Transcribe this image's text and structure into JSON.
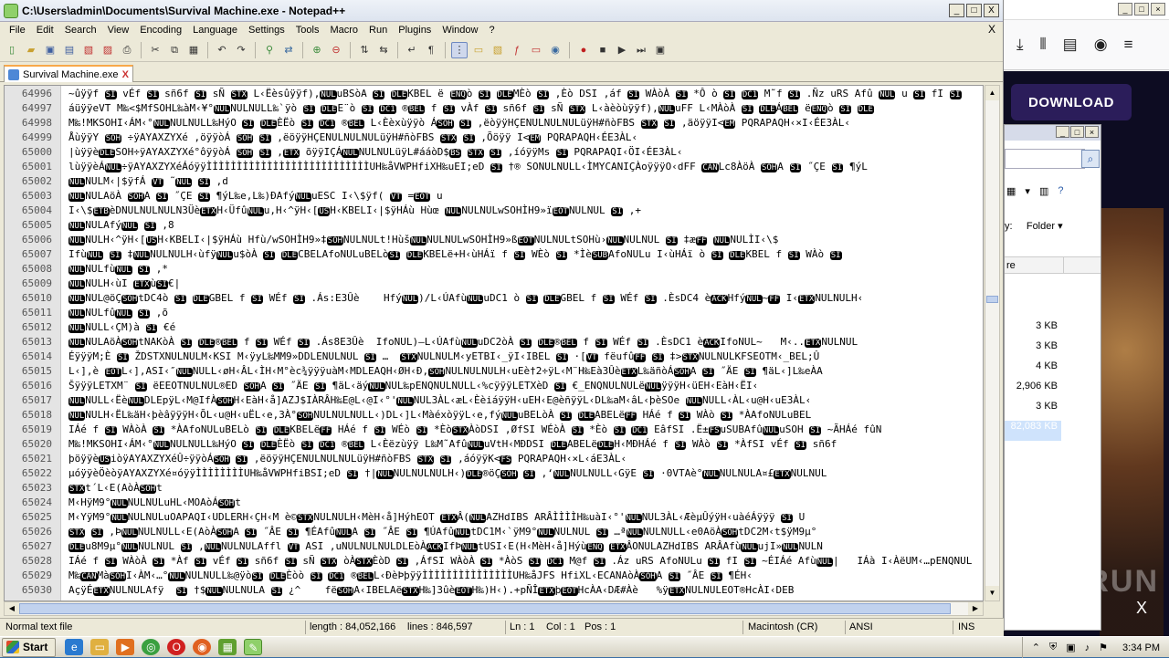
{
  "window": {
    "title": "C:\\Users\\admin\\Documents\\Survival Machine.exe - Notepad++",
    "controls": {
      "minimize": "_",
      "maximize": "□",
      "close": "X"
    }
  },
  "menu": [
    "File",
    "Edit",
    "Search",
    "View",
    "Encoding",
    "Language",
    "Settings",
    "Tools",
    "Macro",
    "Run",
    "Plugins",
    "Window",
    "?"
  ],
  "menu_close": "X",
  "toolbar_icons": [
    "new-file-icon",
    "open-file-icon",
    "save-icon",
    "save-all-icon",
    "close-icon",
    "close-all-icon",
    "print-icon",
    "cut-icon",
    "copy-icon",
    "paste-icon",
    "undo-icon",
    "redo-icon",
    "find-icon",
    "replace-icon",
    "zoom-in-icon",
    "zoom-out-icon",
    "sync-v-icon",
    "sync-h-icon",
    "wrap-icon",
    "all-chars-icon",
    "indent-guide-icon",
    "udl-icon",
    "doc-map-icon",
    "function-list-icon",
    "folder-workspace-icon",
    "monitor-icon",
    "record-macro-icon",
    "stop-macro-icon",
    "play-macro-icon",
    "run-macro-multiple-icon",
    "save-macro-icon"
  ],
  "tab": {
    "label": "Survival Machine.exe",
    "close": "X"
  },
  "lines": [
    {
      "n": "64996",
      "t": "~ûÿÿf SI vÉf SI sñ6f SI sÑ STX L‹Ëèsûÿÿf)‚NULuBSòA SI DLEKBEL ë ENQò SI DLEMÈò SI ,Èò DSI ,áf SI WÀòÀ SI *Ô ò SI DC1 M˜f SI .Ñz uRS Afû NUL u SI fI SI"
    },
    {
      "n": "64997",
      "t": "áüÿÿeVT M‰<$MfSOHL‰àM‹¥°NULNULNULL‰`ÿò SI DLEE¨ò SI DC1 ®BEL f SI vÀf SI sñ6f SI sÑ STX L‹àèòùÿÿf)‚NULuFF L‹MÀòÀ SI DLEÁBEL ëENQò SI DLE"
    },
    {
      "n": "64998",
      "t": "M‰!MKSOHI‹ÁM‹°NULNULNULL‰HýO SI DLEÈËò SI DC1 ®BEL L‹Èèxùÿÿò ÁSOH SI ,ëòÿÿHÇENULNULNULüÿH#ñòFBS STX SI ,äöÿÿI<EM PQRAPAQH‹×I‹ÉE3ÀL‹"
    },
    {
      "n": "64999",
      "t": "ÅùÿÿY SOH ÷ÿAYAXZYXé ,öÿÿòÁ SOH SI ,ëöÿÿHÇENULNULNULüÿH#ñòFBS STX SI ,Õöÿÿ I<EM PQRAPAQH‹ÉE3ÀL‹"
    },
    {
      "n": "65000",
      "t": "|ùÿÿèDLESOH÷ÿAYAXZYXé°ôÿÿòÁ SOH SI ,ETX õÿÿIÇÁNULNULNULüÿL#ááòD$BS STX SI ,íóÿÿMs SI PQRAPAQI‹ÖI‹ÉE3ÀL‹"
    },
    {
      "n": "65001",
      "t": "lùÿÿèÁNUL÷ÿAYAXZYXéÁóÿÿÌÌÌÌÌÌÌÌÌÌÌÌÌÌÌÌÌÌÌÌÌÌÌÌÌÌÌUH‰åVWPHfiXH‰uEI;eD SI †® SONULNULL‹ÌMYCANIÇÀoÿÿÿO‹dFF CANLc8ÀöÀ SOHA SI ˝ÇE SI ¶ýL"
    },
    {
      "n": "65002",
      "t": "NULNULM‹|$ÿfÁ VT ˜NUL SI ,d"
    },
    {
      "n": "65003",
      "t": "NULNULAöÀ SOHA SI ˝ÇE SI ¶ýL‰e,L‰)ÐAfýNULuESC I‹\\$ÿf( VT =EOT u"
    },
    {
      "n": "65004",
      "t": "I‹\\$ETBèDNULNULNULN3ÜèETXH‹ÜfûNULu,H‹^ÿH‹[USH‹KBELI‹|$ÿHÁù Hùœ NULNULNULwSOHÌH9»ïEOTNULNUL SI ,+"
    },
    {
      "n": "65005",
      "t": "NULNULAfýNUL SI ,8"
    },
    {
      "n": "65006",
      "t": "NULNULH‹^ÿH‹[USH‹KBELI‹|$ÿHÁù Hfù/wSOHÌH9»‡SOHNULNULt!HùšNULNULNULwSOHÌH9»ßEOTNULNULtSOHù›NULNULNUL SI ‡æFF NULNULÌI‹\\$"
    },
    {
      "n": "65007",
      "t": "IfùNUL SI ‡NULNULNULH‹ùfÿNULu$òÀ SI DLECBELAfoNULuBELòSI DLEKBELë+H‹ùHÁï f SI WÈò SI *ÌèSUBAfoNULu I‹ùHÁï ò SI DLEKBEL f SI WÀò SI"
    },
    {
      "n": "65008",
      "t": "NULNULfùNUL SI ,*"
    },
    {
      "n": "65009",
      "t": "NULNULH‹ùI ETXùSI€|"
    },
    {
      "n": "65010",
      "t": "NULNUL@öÇSOHtDC4ò SI DLEGBEL f SI WÉf SI .Ás:E3Ûè    HfýNUL)/L‹ÚAfùNULuDC1 ò SI DLEGBEL f SI WÉf SI .ÈsDC4 èACKHfýNUL~FF I‹ETXNULNULH‹"
    },
    {
      "n": "65011",
      "t": "NULNULfûNUL SI ,õ"
    },
    {
      "n": "65012",
      "t": "NULNULL‹ÇM)à SI €é"
    },
    {
      "n": "65013",
      "t": "NULNULAöÀSOHtNAKòÀ SI DLE®BEL f SI WÉf SI .Ás8E3Ûè  IfoNUL)–L‹ÚAfùNULuDC2òÀ SI DLE®BEL f SI WÉf SI .ÈsDC1 èACKIfoNUL~   M‹..ETXNULNUL"
    },
    {
      "n": "65014",
      "t": "ÉÿÿÿM;È SI ŽDSTXNULNULM‹KSI M‹ÿyL‰MM9»DDLENULNUL SI …  STXNULNULM‹yETBI‹_ÿI‹IBEL SI ·[VT fëufûFF SI ‡>STXNULNULKFSEOTM‹_BEL;Û"
    },
    {
      "n": "65015",
      "t": "L‹]‚è EOTL‹]‚ASI‹″NULNULL‹øH‹ÂL‹ÌH‹M°èc¾ÿÿÿuàM‹MDLEAQH‹ØH‹Ð‚SOHNULNULNULH‹uEè†2÷ÿL‹M¨H‰Eà3ÛèETXL‰äñòÁSOHA SI ˝ÄE SI ¶äL‹]L‰eÀA"
    },
    {
      "n": "65016",
      "t": "ŠÿÿÿLETXM¨ SI ëEEOTNULNUL®ED SOHA SI ˝ÄE SI ¶äL‹äýNULNUL‰pENQNULNULL‹%cÿÿÿLETXèD SI €_ENQNULNULëNULÿÿÿH‹üEH‹EàH‹ËI‹"
    },
    {
      "n": "65017",
      "t": "NULNULL‹ËèNULDLEpÿL‹M@IfÀSOHH‹EàH‹å]AZJ$IÀRÂH‰E@L‹@I‹°'NULNUL3ÀL‹æL‹ÈèiáÿÿH‹uEH‹E@èñÿÿL‹DL‰aM‹âL‹þèSOe NULNULL‹ÀL‹u@H‹uE3ÀL‹"
    },
    {
      "n": "65018",
      "t": "NULNULH‹ËL‰äH‹þèâÿÿÿH‹ÕL‹u@H‹uËL‹e,3À°SOHNULNULNULL‹)DL‹]L‹MàéxòÿÿL‹e,fýNULuBELòÀ SI DLEABELëFF HÁé f SI WÀò SI *ÀAfoNULuBEL"
    },
    {
      "n": "65019",
      "t": "IÁé f SI WÀòÀ SI *ÀAfoNULuBELò SI DLEKBELëFF HÁé f SI WÉò SI *ÈòSTXÀòDSI ,ØfSI WÉòÀ SI *Èò SI DC1 EâfSI .Ë±FSuSUBAfûNULuSOH SI ~ÃHÁé fûN"
    },
    {
      "n": "65020",
      "t": "M‰!MKSOHI‹ÁM‹°NULNULNULL‰HýO SI DLEÈËò SI DC1 ®BEL L‹Èëzùÿÿ L‰M˜AfûNULuVtH‹MÐDSI DLEABELëDLEH‹MÐHÁé f SI WÀò SI *ÀfSI vÉf SI sñ6f"
    },
    {
      "n": "65021",
      "t": "þöÿÿèUSiòÿAYAXZYXéÛ÷ÿÿòÁSOH SI ,ëöÿÿHÇENULNULNULüÿH#ñòFBS STX SI ,áóÿÿK<FS PQRAPAQH‹×L‹áE3ÀL‹"
    },
    {
      "n": "65022",
      "t": "µóÿÿèÖèòÿAYAXZYXé¤óÿÿÌÌÌÌÌÌÌÌUH‰åVWPHfiBSI;eD SI †|NULNULNULNULH‹)DLE®öÇSOH SI ,‘NULNULNULL‹GÿE SI ·0VTAè°NULNULNULA¤£ETXNULNUL"
    },
    {
      "n": "65023",
      "t": "STXt´L‹E(AòÀSOHt"
    },
    {
      "n": "65024",
      "t": "M‹HÿM9°NULNULNULuHL‹MOAòÁSOHt"
    },
    {
      "n": "65025",
      "t": "M‹YÿM9°NULNULNULuOAPAQI‹UDLERH‹ÇH‹M è©STXNULNULH‹MèH‹å]HýhEOT ETXÂ(NULAZHdIBS ARÂÌÌÌÌH‰uàI‹°'NULNUL3ÀL‹ÆèµÛýÿH‹uàéÁÿÿÿ SI U"
    },
    {
      "n": "65026",
      "t": "STX SI ,ÞNULNULNULL‹E(AòÀSOHA SI ˝ÂE SI ¶ÉAfûNULA SI ˝ÂE SI ¶ÚAfûNULtDC1M‹`ÿM9°NULNULNUL SI …ªNULNULNULL‹e0AöÀSOHtDC2M‹t$ÿM9µ°"
    },
    {
      "n": "65027",
      "t": "DLEu8M9µ°NULNULNUL SI ,NULNULNULAffl VT ASI ,uNULNULNULDLEòÀACKIfÞNULtUSI‹E(H‹MèH‹å]HýùENQ ETXÂONULAZHdIBS ARÂAfùNULujI»NULNULN"
    },
    {
      "n": "65028",
      "t": "IÁé f SI WÀòÀ SI *Àf SI vÉf SI sñ6f SI sÑ STX òÀSTXÈòD SI ,ÁfSI WÀòÀ SI *ÀòS SI DC1 M@f SI .Áz uRS AfoNULu SI fI SI ~ÉIÁé AfùNUL|   IÁà I‹ÀëUM‹…pENQNUL"
    },
    {
      "n": "65029",
      "t": "M‰CANMàSOHI‹ÀM‹…°NULNULNULL‰@ÿòSI DLEÈòò SI DC1 ®BELL‹ÐèÞþÿÿÌÌÌÌÌÌÌÌÌÌÌÌÌÌÌUH‰åJFS HfiXL‹ECANAòÀSOHA SI ˝ÂE SI ¶ÉH‹"
    },
    {
      "n": "65030",
      "t": "AçÿÉETXNULNULAfÿ  SI †$NULNULNULA SI ¿^    fëSOHA‹IBELAëSTXH‰]3ûèEOTH‰)H‹).+pÑÎETXþEOTHcÀA‹DÆ#Àè   %ÿETXNULNULEOT®HcÀI‹DEB"
    }
  ],
  "status": {
    "file_type": "Normal text file",
    "length": "length : 84,052,166",
    "lines": "lines : 846,597",
    "ln": "Ln : 1",
    "col": "Col : 1",
    "pos": "Pos : 1",
    "eol": "Macintosh (CR)",
    "encoding": "ANSI",
    "mode": "INS"
  },
  "browser": {
    "download_label": "DOWNLOAD",
    "watermark": "ANY RUN",
    "close": "X"
  },
  "dialog": {
    "view_label": "Folder",
    "col_header": "re",
    "sizes": [
      "3 KB",
      "3 KB",
      "4 KB",
      "2,906 KB",
      "3 KB",
      "82,083 KB"
    ]
  },
  "taskbar": {
    "start_label": "Start",
    "clock": "3:34 PM"
  }
}
